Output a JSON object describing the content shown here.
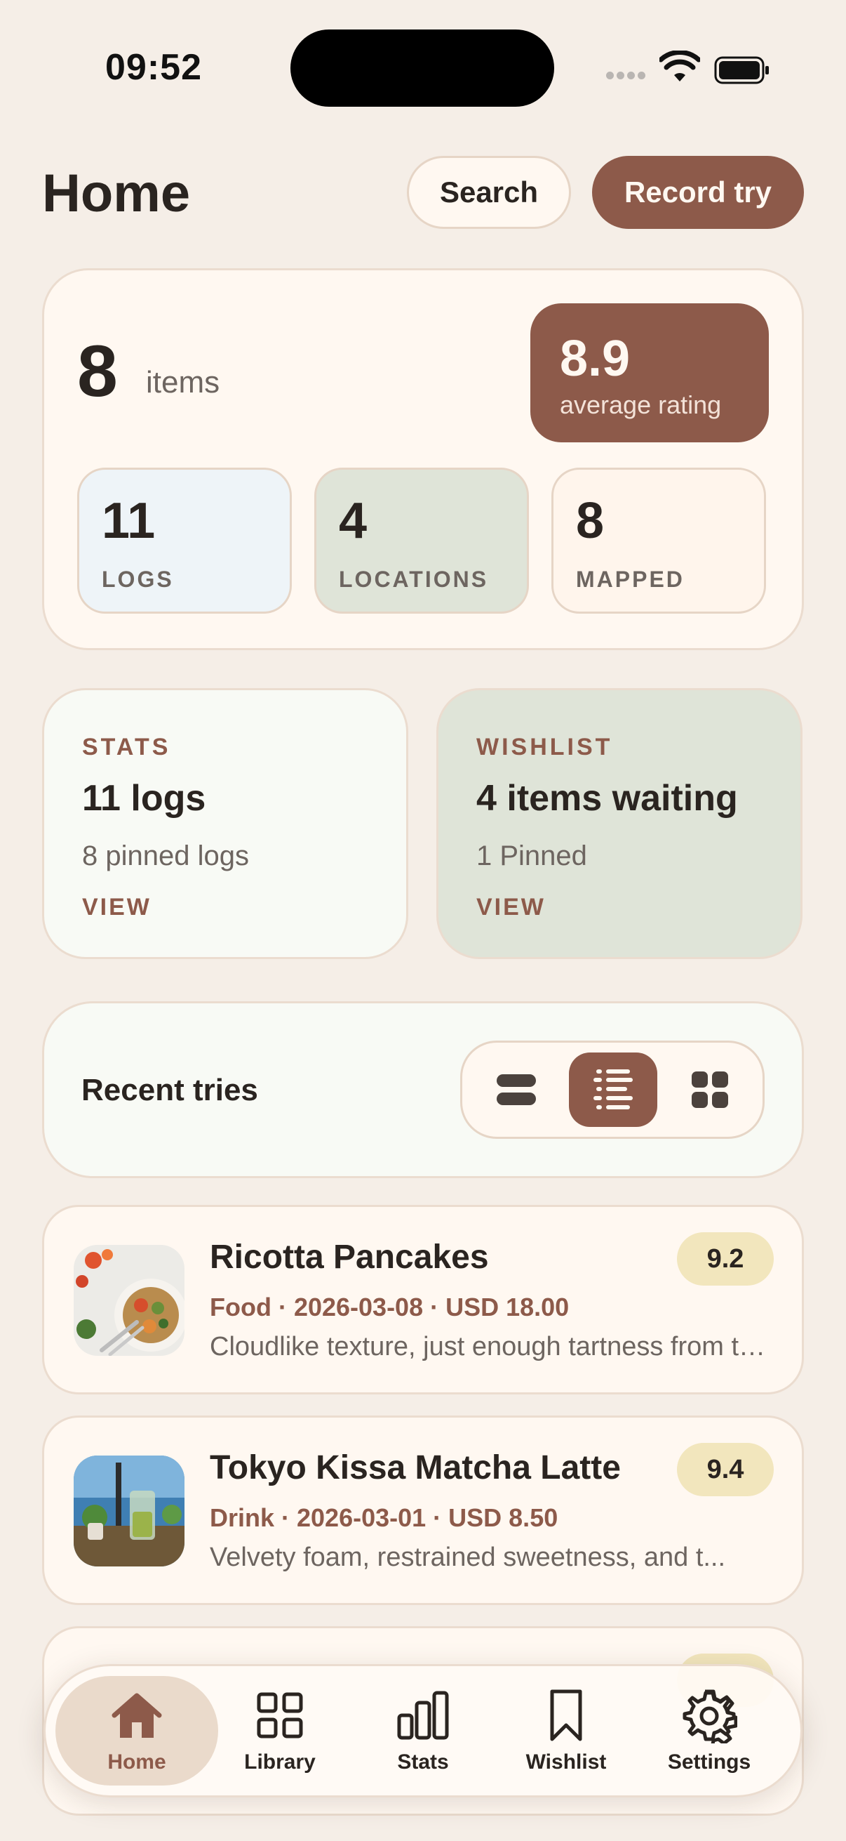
{
  "status_bar": {
    "time": "09:52"
  },
  "header": {
    "title": "Home",
    "search_label": "Search",
    "record_label": "Record try"
  },
  "summary": {
    "item_count": "8",
    "item_label": "items",
    "average_rating": "8.9",
    "average_label": "average rating",
    "tiles": [
      {
        "value": "11",
        "label": "LOGS"
      },
      {
        "value": "4",
        "label": "LOCATIONS"
      },
      {
        "value": "8",
        "label": "MAPPED"
      }
    ]
  },
  "stats_panel": {
    "eyebrow": "STATS",
    "headline": "11 logs",
    "sub": "8 pinned logs",
    "link": "VIEW"
  },
  "wishlist_panel": {
    "eyebrow": "WISHLIST",
    "headline": "4 items waiting",
    "sub": "1 Pinned",
    "link": "VIEW"
  },
  "recent": {
    "title": "Recent tries",
    "view_modes": [
      "cards-view-icon",
      "list-view-icon",
      "grid-view-icon"
    ],
    "selected_view": "list"
  },
  "tries": [
    {
      "name": "Ricotta Pancakes",
      "meta": "Food · 2026-03-08 · USD 18.00",
      "note": "Cloudlike texture, just enough tartness from the ricotta and berries",
      "score": "9.2"
    },
    {
      "name": "Tokyo Kissa Matcha Latte",
      "meta": "Drink · 2026-03-01 · USD 8.50",
      "note": "Velvety foam, restrained sweetness, and t...",
      "score": "9.4"
    }
  ],
  "tabbar": {
    "active": "Home",
    "tabs": [
      {
        "label": "Home",
        "icon": "home-icon"
      },
      {
        "label": "Library",
        "icon": "grid-icon"
      },
      {
        "label": "Stats",
        "icon": "bar-chart-icon"
      },
      {
        "label": "Wishlist",
        "icon": "bookmark-icon"
      },
      {
        "label": "Settings",
        "icon": "gear-icon"
      }
    ]
  },
  "colors": {
    "background": "#f5eee7",
    "accent": "#8d5a4a",
    "card": "#fff8f1",
    "sage": "#dfe4d8",
    "score_badge": "#f2e6bd"
  }
}
